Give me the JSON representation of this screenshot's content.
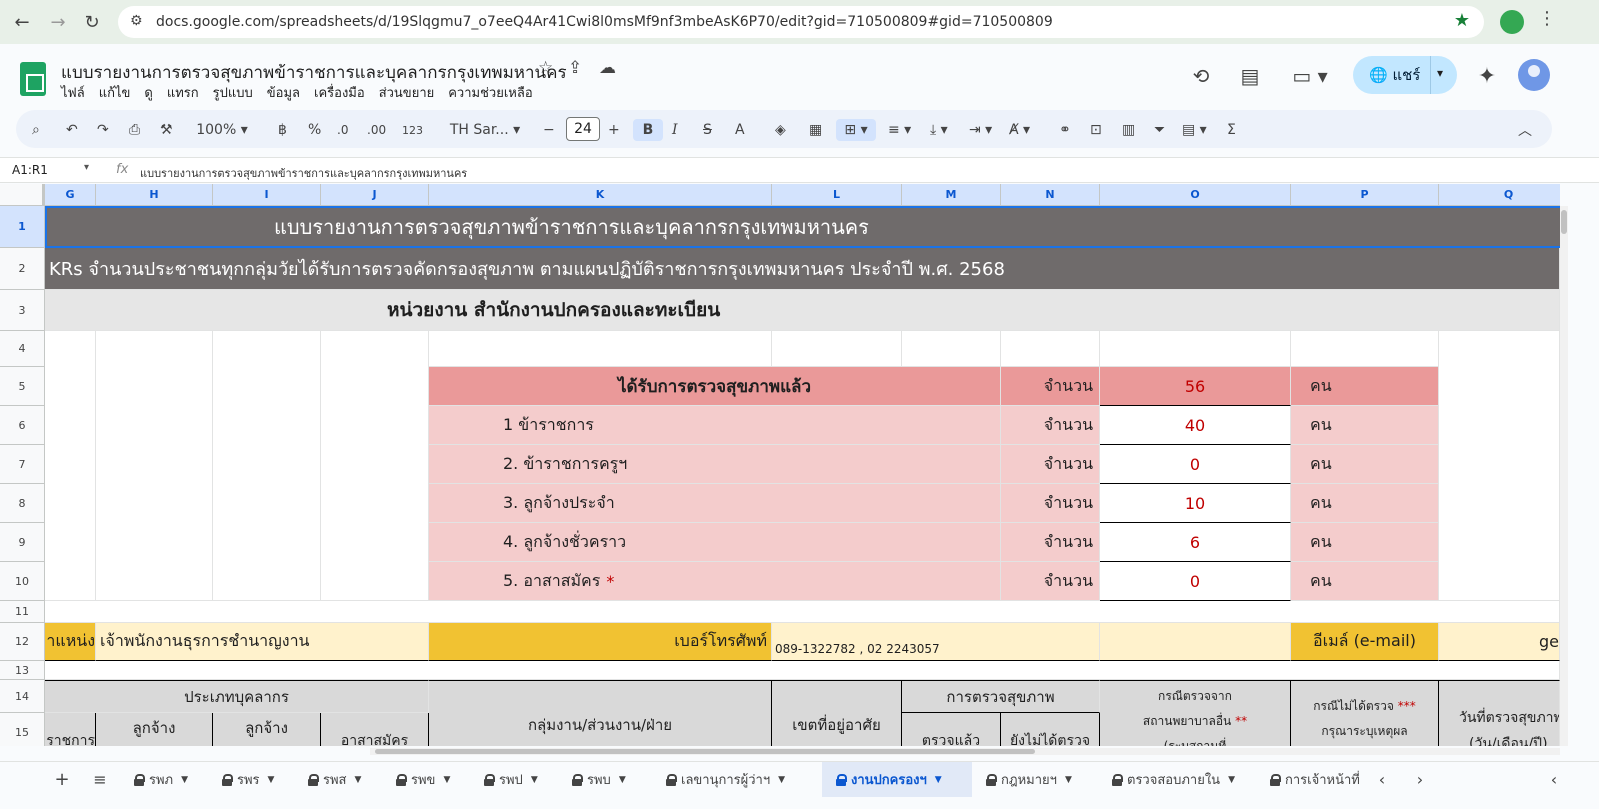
{
  "browser": {
    "url": "docs.google.com/spreadsheets/d/19Slqgmu7_o7eeQ4Ar41Cwi8l0msMf9nf3mbeAsK6P70/edit?gid=710500809#gid=710500809"
  },
  "header": {
    "title": "แบบรายงานการตรวจสุขภาพข้าราชการและบุคลากรกรุงเทพมหานคร",
    "menu": [
      "ไฟล์",
      "แก้ไข",
      "ดู",
      "แทรก",
      "รูปแบบ",
      "ข้อมูล",
      "เครื่องมือ",
      "ส่วนขยาย",
      "ความช่วยเหลือ"
    ],
    "share_label": "แชร์"
  },
  "toolbar": {
    "zoom": "100%",
    "currency": "฿",
    "percent": "%",
    "dec_decrease": ".0",
    "dec_increase": ".00",
    "number_format": "123",
    "font_name": "TH Sar...",
    "font_size": "24"
  },
  "formula_bar": {
    "name_box": "A1:R1",
    "fx": "fx",
    "content": "แบบรายงานการตรวจสุขภาพข้าราชการและบุคลากรกรุงเทพมหานคร"
  },
  "columns": [
    "G",
    "H",
    "I",
    "J",
    "K",
    "L",
    "M",
    "N",
    "O",
    "P",
    "Q"
  ],
  "rows": [
    "1",
    "2",
    "3",
    "4",
    "5",
    "6",
    "7",
    "8",
    "9",
    "10",
    "11",
    "12",
    "13",
    "14",
    "15"
  ],
  "sheet": {
    "r1": "แบบรายงานการตรวจสุขภาพข้าราชการและบุคลากรกรุงเทพมหานคร",
    "r2": "KRs จำนวนประชาชนทุกกลุ่มวัยได้รับการตรวจคัดกรองสุขภาพ ตามแผนปฏิบัติราชการกรุงเทพมหานคร ประจำปี พ.ศ. 2568",
    "r3": "หน่วยงาน สำนักงานปกครองและทะเบียน",
    "summary_title": "ได้รับการตรวจสุขภาพแล้ว",
    "count_label": "จำนวน",
    "unit": "คน",
    "total": "56",
    "items": [
      {
        "label": "1 ข้าราชการ",
        "value": "40"
      },
      {
        "label": "2. ข้าราชการครูฯ",
        "value": "0"
      },
      {
        "label": "3. ลูกจ้างประจำ",
        "value": "10"
      },
      {
        "label": "4. ลูกจ้างชั่วคราว",
        "value": "6"
      },
      {
        "label": "5. อาสาสมัคร",
        "value": "0"
      }
    ],
    "asterisk": "*",
    "r12_position_label": "าแหน่ง",
    "r12_position_value": "เจ้าพนักงานธุรการชำนาญงาน",
    "r12_phone_label": "เบอร์โทรศัพท์",
    "r12_phone_value": "089-1322782 , 02 2243057",
    "r12_email_label": "อีเมล์ (e-mail)",
    "r12_email_value": "ge",
    "r14_personnel_type": "ประเภทบุคลากร",
    "r14_health_check": "การตรวจสุขภาพ",
    "r14_other_hospital_1": "กรณีตรวจจาก",
    "r14_other_hospital_2": "สถานพยาบาลอื่น",
    "r14_other_hospital_3": "(ระบุสถานที่",
    "double_star": "**",
    "r14_not_checked_1": "กรณีไม่ได้ตรวจ",
    "r14_not_checked_2": "กรุณาระบุเหตุผล",
    "triple_star": "***",
    "r14_date_1": "วันที่ตรวจสุขภาพ",
    "r14_date_2": "(วัน/เดือน/ปี)",
    "r14_group": "กลุ่มงาน/ส่วนงาน/ฝ่าย",
    "r14_district": "เขตที่อยู่อาศัย",
    "r15_g": "ชาราชการ",
    "r15_h": "ลูกจ้าง",
    "r15_i": "ลูกจ้าง",
    "r15_j": "อาสาสมัคร",
    "r15_m": "ตรวจแล้ว",
    "r15_n": "ยังไม่ได้ตรวจ"
  },
  "tabs": {
    "items": [
      "รพภ",
      "รพร",
      "รพส",
      "รพข",
      "รพป",
      "รพบ",
      "เลขานุการผู้ว่าฯ",
      "งานปกครองฯ",
      "กฎหมายฯ",
      "ตรวจสอบภายใน",
      "การเจ้าหน้าที่"
    ],
    "active": "งานปกครองฯ"
  },
  "colors": {
    "title_bg": "#6f6b6b",
    "subtitle_bg": "#e6e6e6",
    "summary_dark": "#ea9999",
    "summary_light": "#f4cccc",
    "value_red": "#c00000",
    "yellow_dark": "#f1c232",
    "yellow_light": "#fff2cc",
    "header_gray": "#d9d9d9"
  }
}
